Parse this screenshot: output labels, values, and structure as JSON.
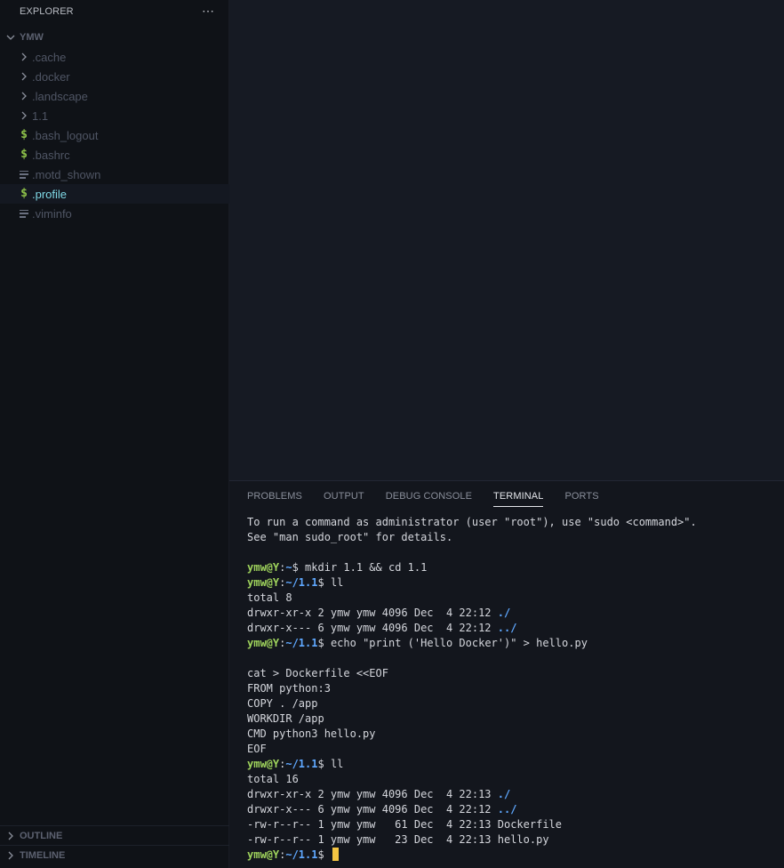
{
  "sidebar": {
    "header": "EXPLORER",
    "more_icon": "⋯",
    "root_folder": "YMW",
    "items": [
      {
        "label": ".cache",
        "icon": "chevron-right-icon",
        "type": "folder"
      },
      {
        "label": ".docker",
        "icon": "chevron-right-icon",
        "type": "folder"
      },
      {
        "label": ".landscape",
        "icon": "chevron-right-icon",
        "type": "folder"
      },
      {
        "label": "1.1",
        "icon": "chevron-right-icon",
        "type": "folder"
      },
      {
        "label": ".bash_logout",
        "icon": "shell-icon",
        "type": "shell"
      },
      {
        "label": ".bashrc",
        "icon": "shell-icon",
        "type": "shell"
      },
      {
        "label": ".motd_shown",
        "icon": "text-file-icon",
        "type": "text"
      },
      {
        "label": ".profile",
        "icon": "shell-icon",
        "type": "shell",
        "selected": true
      },
      {
        "label": ".viminfo",
        "icon": "text-file-icon",
        "type": "text"
      }
    ],
    "outline": "OUTLINE",
    "timeline": "TIMELINE"
  },
  "panel": {
    "tabs": [
      {
        "label": "PROBLEMS"
      },
      {
        "label": "OUTPUT"
      },
      {
        "label": "DEBUG CONSOLE"
      },
      {
        "label": "TERMINAL",
        "active": true
      },
      {
        "label": "PORTS"
      }
    ]
  },
  "terminal": {
    "prompt_user": "ymw@Y",
    "lines": [
      {
        "kind": "text",
        "text": "To run a command as administrator (user \"root\"), use \"sudo <command>\"."
      },
      {
        "kind": "text",
        "text": "See \"man sudo_root\" for details."
      },
      {
        "kind": "text",
        "text": ""
      },
      {
        "kind": "prompt",
        "path": "~",
        "cmd": " mkdir 1.1 && cd 1.1"
      },
      {
        "kind": "prompt",
        "path": "~/1.1",
        "cmd": " ll"
      },
      {
        "kind": "text",
        "text": "total 8"
      },
      {
        "kind": "dir",
        "text": "drwxr-xr-x 2 ymw ymw 4096 Dec  4 22:12 ",
        "link": "./"
      },
      {
        "kind": "dir",
        "text": "drwxr-x--- 6 ymw ymw 4096 Dec  4 22:12 ",
        "link": "../"
      },
      {
        "kind": "prompt",
        "path": "~/1.1",
        "cmd": " echo \"print ('Hello Docker')\" > hello.py"
      },
      {
        "kind": "text",
        "text": ""
      },
      {
        "kind": "text",
        "text": "cat > Dockerfile <<EOF"
      },
      {
        "kind": "text",
        "text": "FROM python:3"
      },
      {
        "kind": "text",
        "text": "COPY . /app"
      },
      {
        "kind": "text",
        "text": "WORKDIR /app"
      },
      {
        "kind": "text",
        "text": "CMD python3 hello.py"
      },
      {
        "kind": "text",
        "text": "EOF"
      },
      {
        "kind": "prompt",
        "path": "~/1.1",
        "cmd": " ll"
      },
      {
        "kind": "text",
        "text": "total 16"
      },
      {
        "kind": "dir",
        "text": "drwxr-xr-x 2 ymw ymw 4096 Dec  4 22:13 ",
        "link": "./"
      },
      {
        "kind": "dir",
        "text": "drwxr-x--- 6 ymw ymw 4096 Dec  4 22:12 ",
        "link": "../"
      },
      {
        "kind": "text",
        "text": "-rw-r--r-- 1 ymw ymw   61 Dec  4 22:13 Dockerfile"
      },
      {
        "kind": "text",
        "text": "-rw-r--r-- 1 ymw ymw   23 Dec  4 22:13 hello.py"
      },
      {
        "kind": "prompt",
        "path": "~/1.1",
        "cmd": " ",
        "cursor": true
      }
    ]
  },
  "colors": {
    "prompt_user": "#9fd35c",
    "prompt_path": "#5fa8ff",
    "cursor": "#f4c542",
    "selected_file": "#7fd9e6",
    "shell_icon": "#8dc149"
  }
}
